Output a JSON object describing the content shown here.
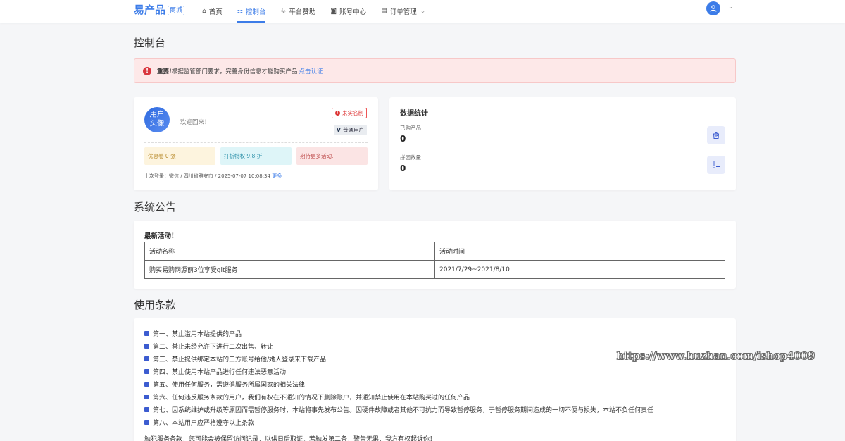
{
  "brand": {
    "name": "易产品",
    "badge": "商城"
  },
  "nav": {
    "items": [
      {
        "icon": "home-icon",
        "label": "首页"
      },
      {
        "icon": "dashboard-icon",
        "label": "控制台"
      },
      {
        "icon": "sponsor-icon",
        "label": "平台赞助"
      },
      {
        "icon": "account-icon",
        "label": "账号中心"
      },
      {
        "icon": "orders-icon",
        "label": "订单管理"
      }
    ],
    "active": "控制台"
  },
  "page": {
    "title": "控制台"
  },
  "alert": {
    "strong": "重要!",
    "text": "根据监管部门要求，完善身份信息才能购买产品",
    "link": "点击认证"
  },
  "user": {
    "avatar_text": "用户\n头像",
    "welcome": "欢迎回来！",
    "verify_badge": "未实名制",
    "level_badge": "普通用户",
    "coupon": "优惠卷 0 张",
    "discount": "打折特权 9.8 折",
    "more_activities": "期待更多活动..",
    "last_login": "上次登录：微信 / 四川省雅安市 / 2025-07-07 10:08:34",
    "more_link": "更多"
  },
  "stats": {
    "title": "数据统计",
    "items": [
      {
        "label": "已购产品",
        "value": "0",
        "icon": "shopping-bag-icon"
      },
      {
        "label": "拼团数量",
        "value": "0",
        "icon": "list-check-icon"
      }
    ]
  },
  "notice": {
    "section_title": "系统公告",
    "heading": "最新活动！",
    "columns": [
      "活动名称",
      "活动时间"
    ],
    "rows": [
      [
        "购买易购网源前3位享受git服务",
        "2021/7/29~2021/8/10"
      ]
    ]
  },
  "terms": {
    "section_title": "使用条款",
    "items": [
      "第一、禁止滥用本站提供的产品",
      "第二、禁止未经允许下进行二次出售、转让",
      "第三、禁止提供绑定本站的三方账号给他/她人登录来下载产品",
      "第四、禁止使用本站产品进行任何违法恶意活动",
      "第五、使用任何服务，需遵循服务所属国家的相关法律",
      "第六、任何违反服务条款的用户，我们有权在不通知的情况下删除账户，并通知禁止使用在本站购买过的任何产品",
      "第七、因系统维护或升级等原因而需暂停服务时，本站将事先发布公告。因硬件故障或者其他不可抗力而导致暂停服务，于暂停服务期间造成的一切不便与损失，本站不负任何责任",
      "第八、本站用户应严格遵守以上条款"
    ],
    "footer": "触犯服务条款，您可能会被保留访问记录，以供日后取证。若触发第二条，警告无果，我方有权起诉你！"
  },
  "watermark": "https://www.huzhan.com/ishop4009"
}
